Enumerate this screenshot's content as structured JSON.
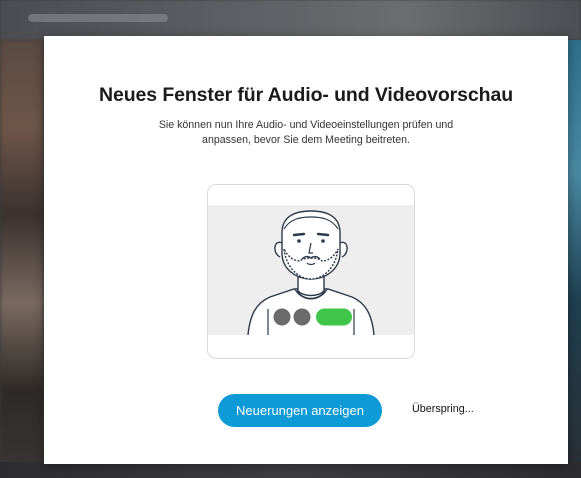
{
  "dialog": {
    "title": "Neues Fenster für Audio- und Videovorschau",
    "description": "Sie können nun Ihre Audio- und Videoeinstellungen prüfen und anpassen, bevor Sie dem Meeting beitreten.",
    "primary_button": "Neuerungen anzeigen",
    "skip_button": "Überspring..."
  },
  "illustration": {
    "control_colors": {
      "mic": "#6b6b6b",
      "video": "#6b6b6b",
      "call": "#3ec54a"
    },
    "accent": "#0e9ad6"
  }
}
